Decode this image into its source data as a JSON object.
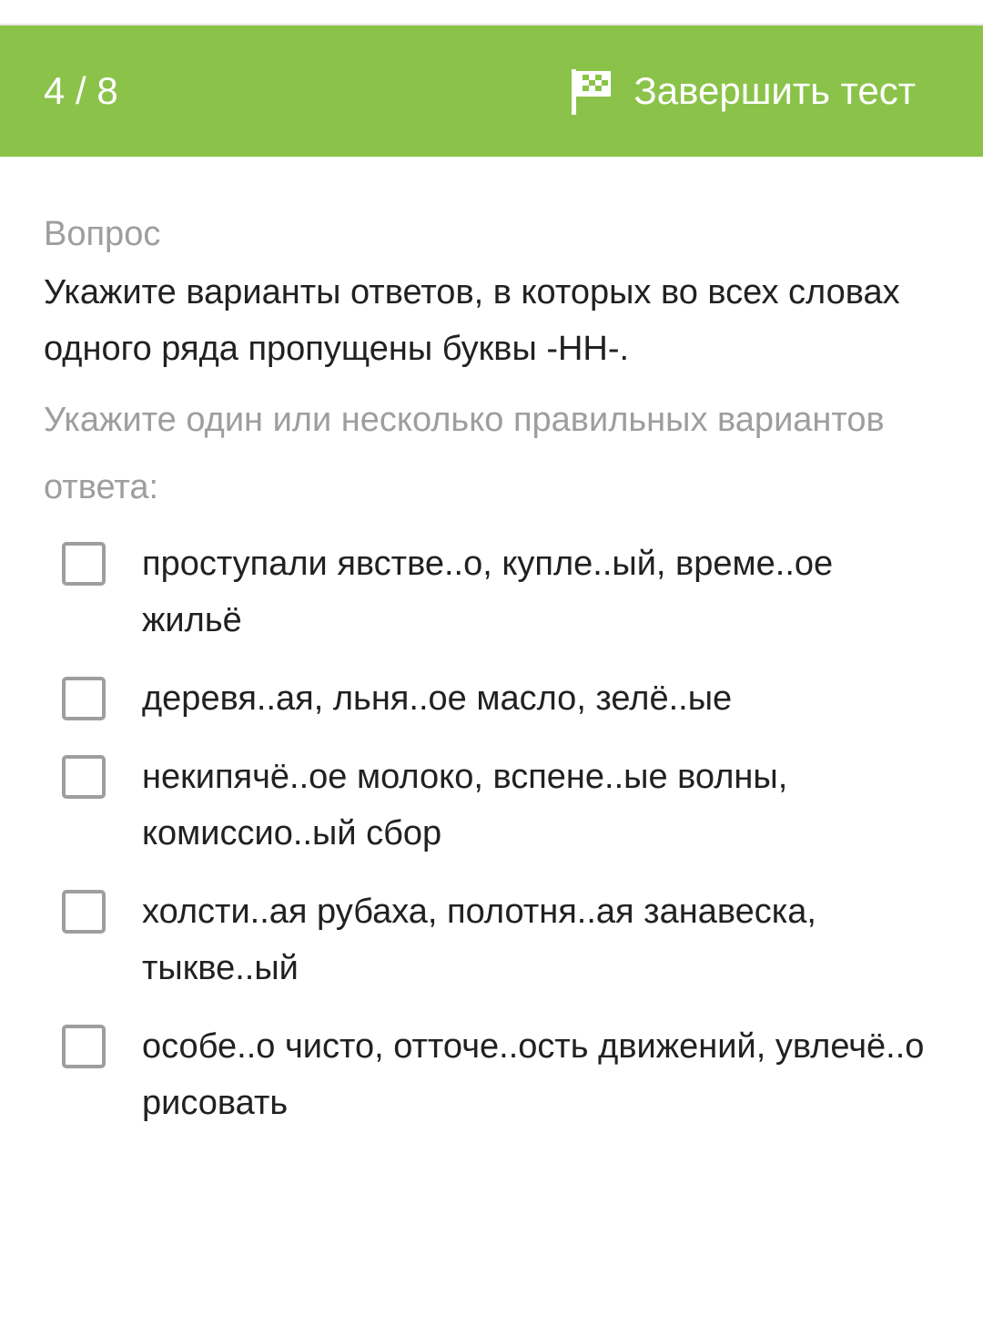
{
  "header": {
    "progress": "4 / 8",
    "finish_label": "Завершить тест",
    "finish_icon": "checkered-flag-icon",
    "background_color": "#8bc34a"
  },
  "question": {
    "label": "Вопрос",
    "text": "Укажите варианты ответов, в которых во всех словах одного ряда пропущены буквы -НН-.",
    "instruction": "Укажите один или несколько правильных вариантов ответа:"
  },
  "options": [
    {
      "text": "проступали явстве..о, купле..ый, време..ое жильё",
      "checked": false
    },
    {
      "text": "деревя..ая, льня..ое масло, зелё..ые",
      "checked": false
    },
    {
      "text": "некипячё..ое молоко, вспене..ые волны, комиссио..ый сбор",
      "checked": false
    },
    {
      "text": "холсти..ая рубаха, полотня..ая занавеска, тыкве..ый",
      "checked": false
    },
    {
      "text": "особе..о чисто, отточе..ость движений, увлечё..о рисовать",
      "checked": false
    }
  ]
}
